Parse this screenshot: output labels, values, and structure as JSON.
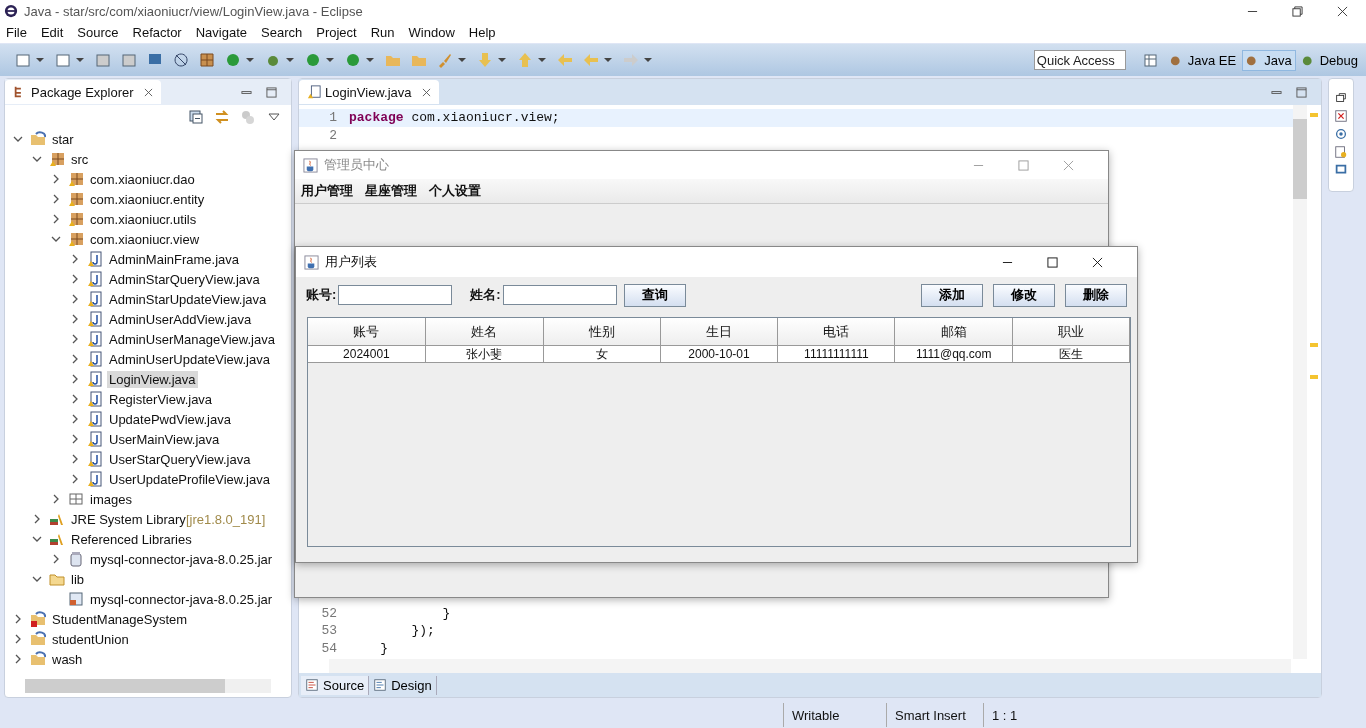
{
  "window": {
    "title": "Java - star/src/com/xiaoniucr/view/LoginView.java - Eclipse"
  },
  "menu": [
    "File",
    "Edit",
    "Source",
    "Refactor",
    "Navigate",
    "Search",
    "Project",
    "Run",
    "Window",
    "Help"
  ],
  "quick_access": {
    "placeholder": "Quick Access"
  },
  "perspectives": [
    {
      "label": "Java EE",
      "selected": false
    },
    {
      "label": "Java",
      "selected": true
    },
    {
      "label": "Debug",
      "selected": false
    }
  ],
  "explorer": {
    "title": "Package Explorer",
    "tree": [
      {
        "label": "star",
        "kind": "project",
        "expanded": true,
        "selected": false,
        "children": [
          {
            "label": "src",
            "kind": "srcfolder",
            "expanded": true,
            "selected": false,
            "children": [
              {
                "label": "com.xiaoniucr.dao",
                "kind": "package",
                "expanded": false,
                "selected": false
              },
              {
                "label": "com.xiaoniucr.entity",
                "kind": "package",
                "expanded": false,
                "selected": false
              },
              {
                "label": "com.xiaoniucr.utils",
                "kind": "package",
                "expanded": false,
                "selected": false
              },
              {
                "label": "com.xiaoniucr.view",
                "kind": "package",
                "expanded": true,
                "selected": false,
                "children": [
                  {
                    "label": "AdminMainFrame.java",
                    "kind": "java",
                    "expanded": false,
                    "selected": false
                  },
                  {
                    "label": "AdminStarQueryView.java",
                    "kind": "java",
                    "expanded": false,
                    "selected": false
                  },
                  {
                    "label": "AdminStarUpdateView.java",
                    "kind": "java",
                    "expanded": false,
                    "selected": false
                  },
                  {
                    "label": "AdminUserAddView.java",
                    "kind": "java",
                    "expanded": false,
                    "selected": false
                  },
                  {
                    "label": "AdminUserManageView.java",
                    "kind": "java",
                    "expanded": false,
                    "selected": false
                  },
                  {
                    "label": "AdminUserUpdateView.java",
                    "kind": "java",
                    "expanded": false,
                    "selected": false
                  },
                  {
                    "label": "LoginView.java",
                    "kind": "java",
                    "expanded": false,
                    "selected": true
                  },
                  {
                    "label": "RegisterView.java",
                    "kind": "java",
                    "expanded": false,
                    "selected": false
                  },
                  {
                    "label": "UpdatePwdView.java",
                    "kind": "java",
                    "expanded": false,
                    "selected": false
                  },
                  {
                    "label": "UserMainView.java",
                    "kind": "java",
                    "expanded": false,
                    "selected": false
                  },
                  {
                    "label": "UserStarQueryView.java",
                    "kind": "java",
                    "expanded": false,
                    "selected": false
                  },
                  {
                    "label": "UserUpdateProfileView.java",
                    "kind": "java",
                    "expanded": false,
                    "selected": false
                  }
                ]
              },
              {
                "label": "images",
                "kind": "folder",
                "expanded": false,
                "selected": false
              }
            ]
          },
          {
            "label": "JRE System Library",
            "decoration": "[jre1.8.0_191]",
            "kind": "library",
            "expanded": false,
            "selected": false
          },
          {
            "label": "Referenced Libraries",
            "kind": "library",
            "expanded": true,
            "selected": false,
            "children": [
              {
                "label": "mysql-connector-java-8.0.25.jar",
                "kind": "jar",
                "expanded": false,
                "selected": false
              }
            ]
          },
          {
            "label": "lib",
            "kind": "openfolder",
            "expanded": true,
            "selected": false,
            "children": [
              {
                "label": "mysql-connector-java-8.0.25.jar",
                "kind": "jarfile",
                "selected": false
              }
            ]
          }
        ]
      },
      {
        "label": "StudentManageSystem",
        "kind": "project-error",
        "expanded": false,
        "selected": false
      },
      {
        "label": "studentUnion",
        "kind": "project",
        "expanded": false,
        "selected": false
      },
      {
        "label": "wash",
        "kind": "project",
        "expanded": false,
        "selected": false
      }
    ]
  },
  "editor": {
    "tab": "LoginView.java",
    "lines_top": [
      {
        "number": "1",
        "keyword": "package",
        "code": " com.xiaoniucr.view;",
        "current": true
      },
      {
        "number": "2",
        "current": false
      }
    ],
    "lines_bottom": [
      {
        "number": "52",
        "code": "            }",
        "current": false
      },
      {
        "number": "53",
        "code": "        });",
        "current": false
      },
      {
        "number": "54",
        "code": "    }",
        "current": false
      }
    ],
    "bottom_tabs": [
      {
        "label": "Source",
        "selected": true
      },
      {
        "label": "Design",
        "selected": false
      }
    ]
  },
  "admin_window": {
    "title": "管理员中心",
    "menu": [
      "用户管理",
      "星座管理",
      "个人设置"
    ]
  },
  "user_list": {
    "title": "用户列表",
    "fields": [
      {
        "label": "账号:"
      },
      {
        "label": "姓名:"
      }
    ],
    "search_button": "查询",
    "actions": [
      "添加",
      "修改",
      "删除"
    ],
    "table": {
      "columns": [
        "账号",
        "姓名",
        "性别",
        "生日",
        "电话",
        "邮箱",
        "职业"
      ],
      "rows": [
        [
          "2024001",
          "张小斐",
          "女",
          "2000-10-01",
          "11111111111",
          "1111@qq.com",
          "医生"
        ]
      ]
    }
  },
  "status_bar": [
    "Writable",
    "Smart Insert",
    "1 : 1"
  ]
}
